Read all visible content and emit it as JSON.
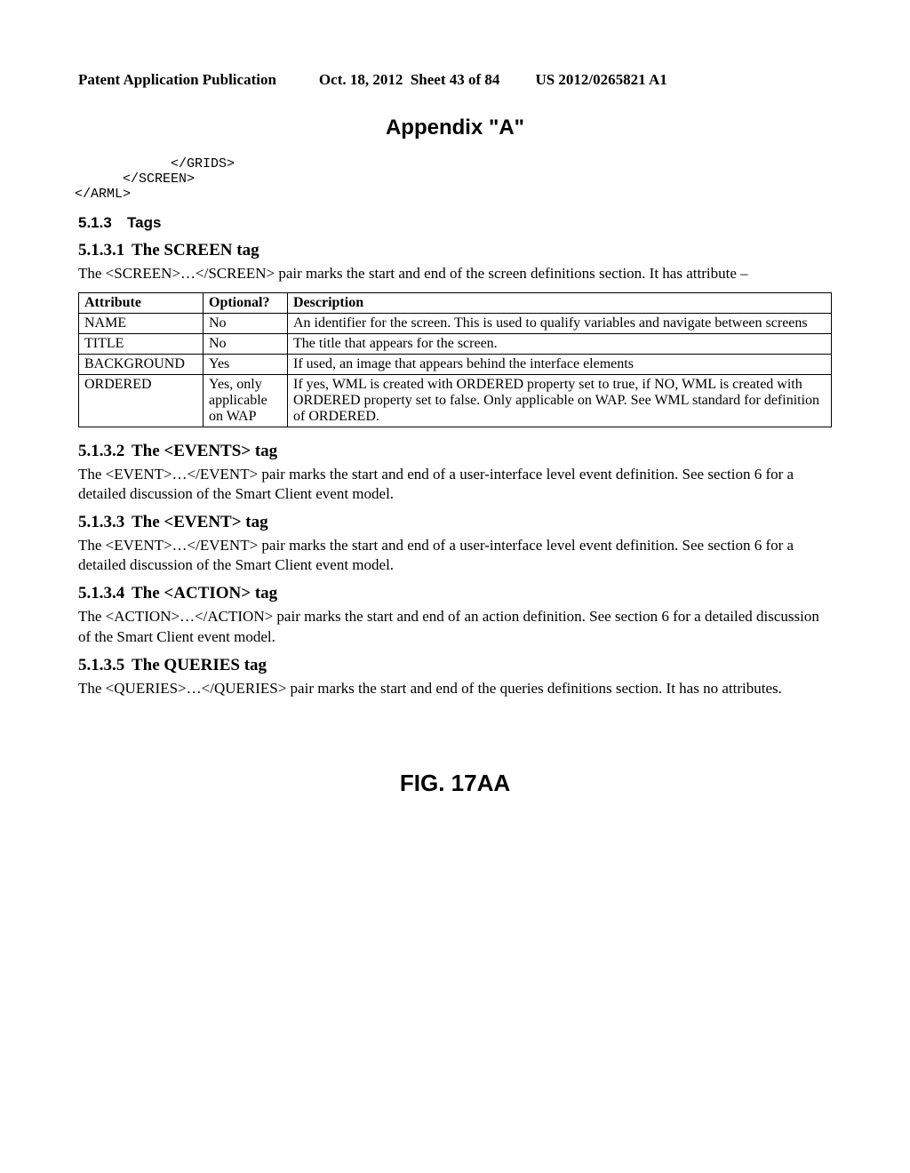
{
  "header": {
    "left": "Patent Application Publication",
    "center": "Oct. 18, 2012  Sheet 43 of 84",
    "right": "US 2012/0265821 A1"
  },
  "appendix_title": "Appendix \"A\"",
  "code_lines": "            </GRIDS>\n      </SCREEN>\n</ARML>",
  "tags_heading": {
    "num": "5.1.3",
    "text": "Tags"
  },
  "sections": [
    {
      "num": "5.1.3.1",
      "title": "The SCREEN tag",
      "body": "The <SCREEN>…</SCREEN> pair marks the start and end of the screen definitions section. It has attribute –"
    },
    {
      "num": "5.1.3.2",
      "title": "The <EVENTS> tag",
      "body": "The <EVENT>…</EVENT> pair marks the start and end of a user-interface level event definition. See section 6 for a detailed discussion of the Smart Client event model."
    },
    {
      "num": "5.1.3.3",
      "title": "The <EVENT> tag",
      "body": "The <EVENT>…</EVENT> pair marks the start and end of a user-interface level event definition. See section 6 for a detailed discussion of the Smart Client event model."
    },
    {
      "num": "5.1.3.4",
      "title": "The <ACTION> tag",
      "body": "The <ACTION>…</ACTION> pair marks the start and end of an action definition. See section 6 for a detailed discussion of the Smart Client event model."
    },
    {
      "num": "5.1.3.5",
      "title": "The QUERIES tag",
      "body": "The <QUERIES>…</QUERIES> pair marks the start and end of the queries definitions section. It has no attributes."
    }
  ],
  "table": {
    "headers": [
      "Attribute",
      "Optional?",
      "Description"
    ],
    "rows": [
      [
        "NAME",
        "No",
        "An identifier for the screen. This is used to qualify variables and navigate between screens"
      ],
      [
        "TITLE",
        "No",
        "The title that appears for the screen."
      ],
      [
        "BACKGROUND",
        "Yes",
        "If used, an image that appears behind the interface elements"
      ],
      [
        "ORDERED",
        "Yes, only applicable on WAP",
        "If yes, WML is created with ORDERED property set to true, if NO, WML is created with ORDERED property set to false. Only applicable on WAP. See WML standard for definition of ORDERED."
      ]
    ]
  },
  "figure_label": "FIG. 17AA"
}
